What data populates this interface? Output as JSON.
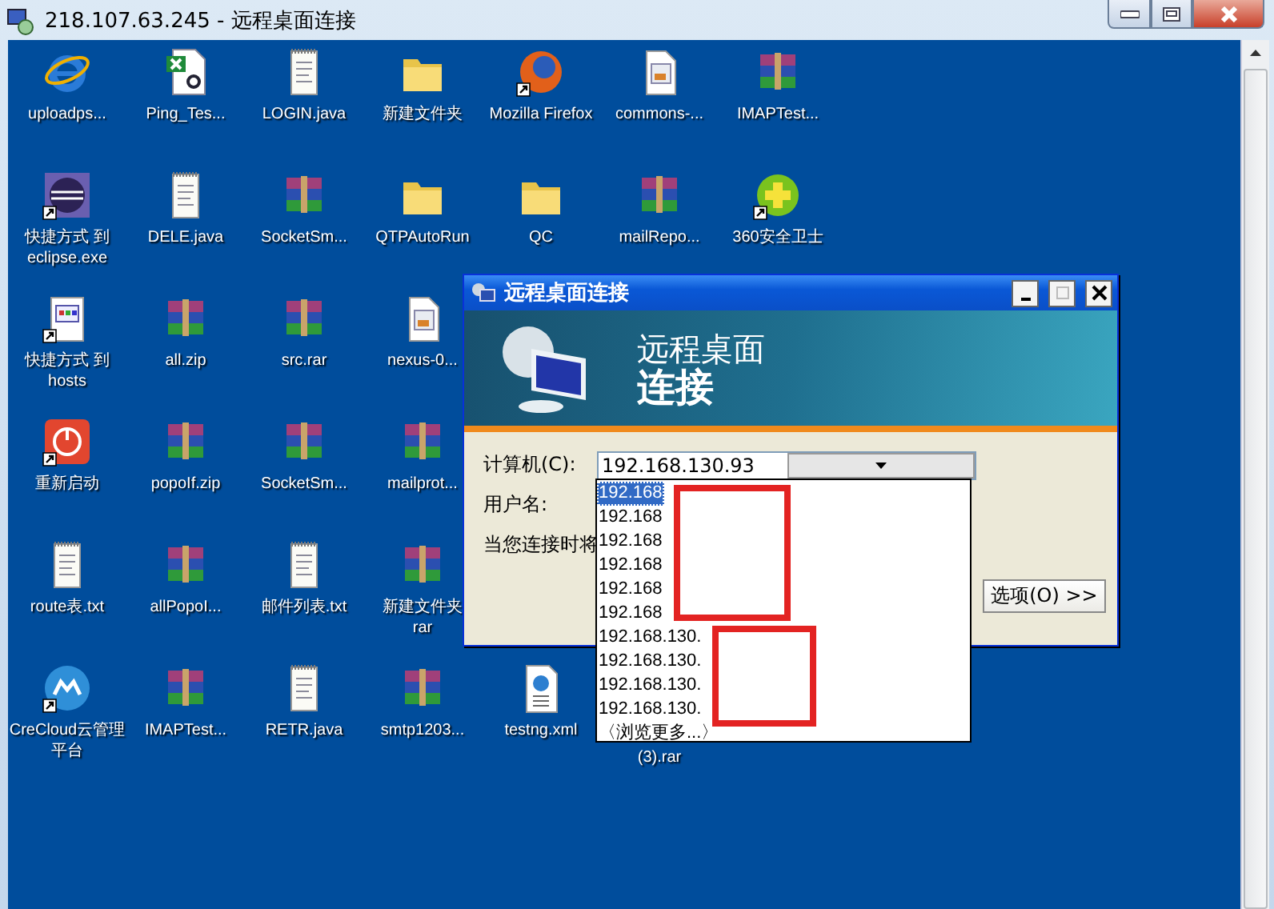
{
  "window": {
    "title": "218.107.63.245 - 远程桌面连接"
  },
  "desktop": {
    "rows": [
      [
        {
          "label": "uploadps...",
          "kind": "browser-e",
          "shortcut": false
        },
        {
          "label": "Ping_Tes...",
          "kind": "spreadsheet",
          "shortcut": false
        },
        {
          "label": "LOGIN.java",
          "kind": "text",
          "shortcut": false
        },
        {
          "label": "新建文件夹",
          "kind": "folder",
          "shortcut": false
        },
        {
          "label": "Mozilla Firefox",
          "kind": "fox",
          "shortcut": true
        },
        {
          "label": "commons-...",
          "kind": "java",
          "shortcut": false
        },
        {
          "label": "IMAPTest...",
          "kind": "archive",
          "shortcut": false
        }
      ],
      [
        {
          "label": "快捷方式 到 eclipse.exe",
          "kind": "eclipse",
          "shortcut": true
        },
        {
          "label": "DELE.java",
          "kind": "text",
          "shortcut": false
        },
        {
          "label": "SocketSm...",
          "kind": "archive",
          "shortcut": false
        },
        {
          "label": "QTPAutoRun",
          "kind": "folder",
          "shortcut": false
        },
        {
          "label": "QC",
          "kind": "folder",
          "shortcut": false
        },
        {
          "label": "mailRepo...",
          "kind": "archive",
          "shortcut": false
        },
        {
          "label": "360安全卫士",
          "kind": "plus",
          "shortcut": true
        }
      ],
      [
        {
          "label": "快捷方式 到 hosts",
          "kind": "config",
          "shortcut": true
        },
        {
          "label": "all.zip",
          "kind": "archive",
          "shortcut": false
        },
        {
          "label": "src.rar",
          "kind": "archive",
          "shortcut": false
        },
        {
          "label": "nexus-0...",
          "kind": "java",
          "shortcut": false
        }
      ],
      [
        {
          "label": "重新启动",
          "kind": "power",
          "shortcut": true
        },
        {
          "label": "popoIf.zip",
          "kind": "archive",
          "shortcut": false
        },
        {
          "label": "SocketSm...",
          "kind": "archive",
          "shortcut": false
        },
        {
          "label": "mailprot...",
          "kind": "archive",
          "shortcut": false
        }
      ],
      [
        {
          "label": "route表.txt",
          "kind": "text",
          "shortcut": false
        },
        {
          "label": "allPopoI...",
          "kind": "archive",
          "shortcut": false
        },
        {
          "label": "邮件列表.txt",
          "kind": "text",
          "shortcut": false
        },
        {
          "label": "新建文件夹\nrar",
          "kind": "archive",
          "shortcut": false
        }
      ],
      [
        {
          "label": "CreCloud云管理平台",
          "kind": "cloud",
          "shortcut": true
        },
        {
          "label": "IMAPTest...",
          "kind": "archive",
          "shortcut": false
        },
        {
          "label": "RETR.java",
          "kind": "text",
          "shortcut": false
        },
        {
          "label": "smtp1203...",
          "kind": "archive",
          "shortcut": false
        },
        {
          "label": "testng.xml",
          "kind": "xml",
          "shortcut": false
        },
        {
          "label": "(3).rar",
          "kind": "covered"
        }
      ]
    ]
  },
  "dialog": {
    "title": "远程桌面连接",
    "banner_line_1": "远程桌面",
    "banner_line_2": "连接",
    "fields": [
      {
        "label": "计算机(C):",
        "kind": "combo",
        "value": "192.168.130.93"
      },
      {
        "label": "用户名:",
        "kind": "label"
      },
      {
        "label": "当您连接时将",
        "kind": "label"
      }
    ],
    "options_button": "选项(O) >>",
    "dropdown": {
      "items": [
        {
          "text": "192.168",
          "selected": true
        },
        {
          "text": "192.168",
          "selected": false
        },
        {
          "text": "192.168",
          "selected": false
        },
        {
          "text": "192.168",
          "selected": false
        },
        {
          "text": "192.168",
          "selected": false
        },
        {
          "text": "192.168",
          "selected": false
        },
        {
          "text": "192.168.130.",
          "selected": false
        },
        {
          "text": "192.168.130.",
          "selected": false
        },
        {
          "text": "192.168.130.",
          "selected": false
        },
        {
          "text": "192.168.130.",
          "selected": false
        }
      ],
      "browse": "〈浏览更多...〉"
    }
  }
}
